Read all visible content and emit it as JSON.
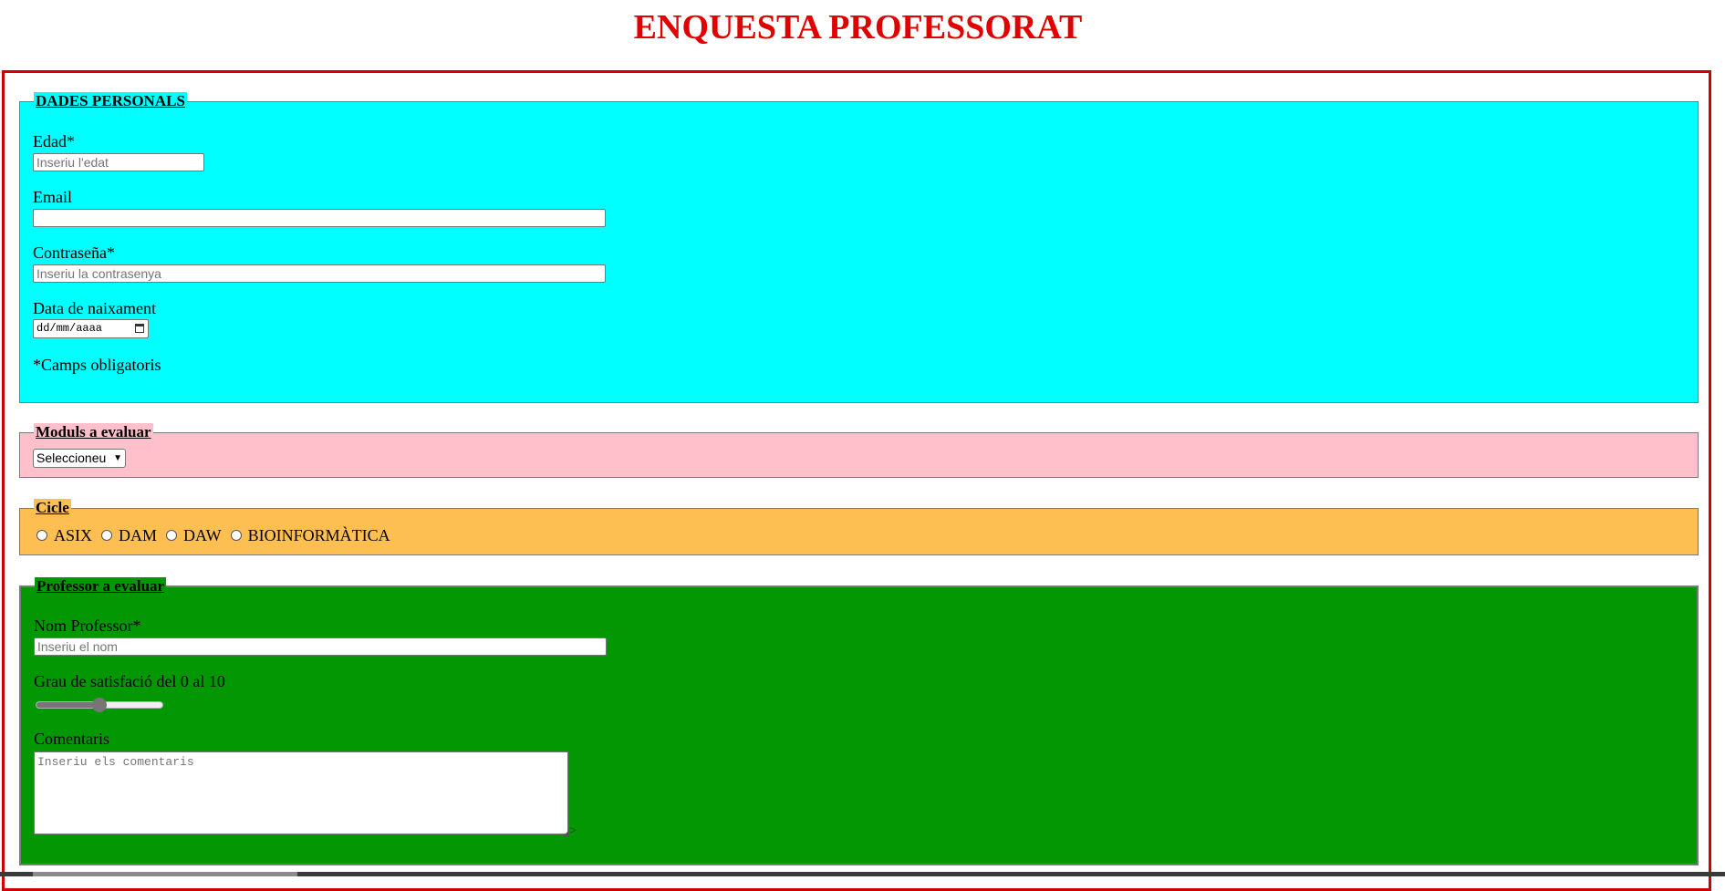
{
  "page": {
    "title": "ENQUESTA PROFESSORAT"
  },
  "colors": {
    "title": "#e00000",
    "personal_bg": "#00ffff",
    "modules_bg": "#ffc0cb",
    "cicle_bg": "#fdbf52",
    "prof_bg": "#039703"
  },
  "personal": {
    "legend": "DADES PERSONALS",
    "age_label": "Edad*",
    "age_placeholder": "Inseriu l'edat",
    "age_value": "",
    "email_label": "Email",
    "email_value": "",
    "password_label": "Contraseña*",
    "password_placeholder": "Inseriu la contrasenya",
    "birth_label": "Data de naixament",
    "birth_placeholder": "dd/mm/aaaa",
    "required_note": "*Camps obligatoris"
  },
  "modules": {
    "legend": "Moduls a evaluar",
    "select_value": "Seleccioneu"
  },
  "cicle": {
    "legend": "Cicle",
    "options": [
      "ASIX",
      "DAM",
      "DAW",
      "BIOINFORMÀTICA"
    ]
  },
  "professor": {
    "legend": "Professor a evaluar",
    "name_label": "Nom Professor*",
    "name_placeholder": "Inseriu el nom",
    "satisfaction_label": "Grau de satisfació del 0 al 10",
    "satisfaction_value": 5,
    "satisfaction_max": 10,
    "comments_label": "Comentaris",
    "comments_placeholder": "Inseriu els comentaris",
    "submit_peek": ">"
  }
}
